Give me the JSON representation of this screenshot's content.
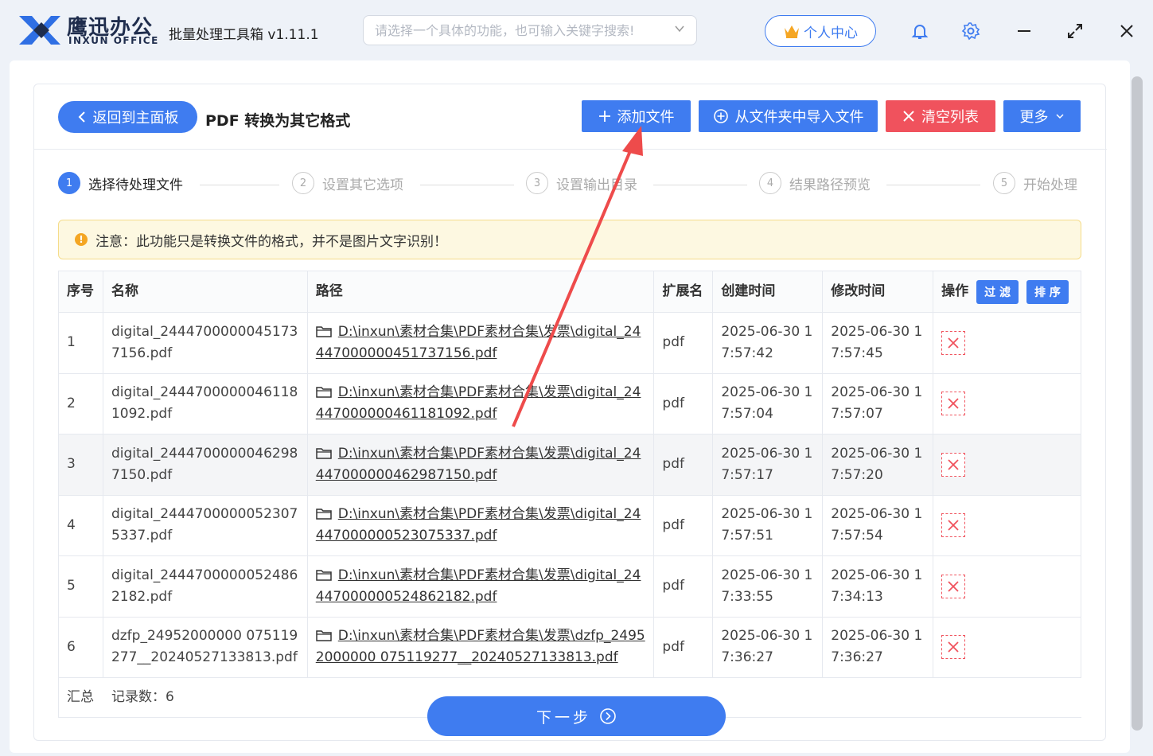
{
  "header": {
    "brand_cn": "鹰迅办公",
    "brand_en": "INXUN OFFICE",
    "app_title": "批量处理工具箱 v1.11.1",
    "search_placeholder": "请选择一个具体的功能，也可输入关键字搜索!",
    "user_center": "个人中心"
  },
  "toolbar": {
    "back_label": "返回到主面板",
    "page_title": "PDF 转换为其它格式",
    "add_file": "添加文件",
    "import_folder": "从文件夹中导入文件",
    "clear_list": "清空列表",
    "more": "更多"
  },
  "steps": [
    {
      "num": "1",
      "label": "选择待处理文件"
    },
    {
      "num": "2",
      "label": "设置其它选项"
    },
    {
      "num": "3",
      "label": "设置输出目录"
    },
    {
      "num": "4",
      "label": "结果路径预览"
    },
    {
      "num": "5",
      "label": "开始处理"
    }
  ],
  "notice": "注意：此功能只是转换文件的格式，并不是图片文字识别！",
  "table": {
    "headers": [
      "序号",
      "名称",
      "路径",
      "扩展名",
      "创建时间",
      "修改时间",
      "操作"
    ],
    "filter_label": "过 滤",
    "sort_label": "排 序",
    "rows": [
      {
        "idx": "1",
        "name": "digital_24447000000451737156.pdf",
        "path": "D:\\inxun\\素材合集\\PDF素材合集\\发票\\digital_24447000000451737156.pdf",
        "ext": "pdf",
        "created": "2025-06-30 17:57:42",
        "modified": "2025-06-30 17:57:45"
      },
      {
        "idx": "2",
        "name": "digital_24447000000461181092.pdf",
        "path": "D:\\inxun\\素材合集\\PDF素材合集\\发票\\digital_24447000000461181092.pdf",
        "ext": "pdf",
        "created": "2025-06-30 17:57:04",
        "modified": "2025-06-30 17:57:07"
      },
      {
        "idx": "3",
        "name": "digital_24447000000462987150.pdf",
        "path": "D:\\inxun\\素材合集\\PDF素材合集\\发票\\digital_24447000000462987150.pdf",
        "ext": "pdf",
        "created": "2025-06-30 17:57:17",
        "modified": "2025-06-30 17:57:20"
      },
      {
        "idx": "4",
        "name": "digital_24447000000523075337.pdf",
        "path": "D:\\inxun\\素材合集\\PDF素材合集\\发票\\digital_24447000000523075337.pdf",
        "ext": "pdf",
        "created": "2025-06-30 17:57:51",
        "modified": "2025-06-30 17:57:54"
      },
      {
        "idx": "5",
        "name": "digital_24447000000524862182.pdf",
        "path": "D:\\inxun\\素材合集\\PDF素材合集\\发票\\digital_24447000000524862182.pdf",
        "ext": "pdf",
        "created": "2025-06-30 17:33:55",
        "modified": "2025-06-30 17:34:13"
      },
      {
        "idx": "6",
        "name": "dzfp_24952000000 075119277__20240527133813.pdf",
        "path": "D:\\inxun\\素材合集\\PDF素材合集\\发票\\dzfp_24952000000 075119277__20240527133813.pdf",
        "ext": "pdf",
        "created": "2025-06-30 17:36:27",
        "modified": "2025-06-30 17:36:27"
      }
    ],
    "footer_label": "汇总",
    "footer_count": "记录数：6"
  },
  "next_button": "下一步",
  "colors": {
    "accent": "#3f7cf0",
    "danger": "#f0525d",
    "notice_bg": "#fdf8e1",
    "annotation_arrow": "#ee4b4b"
  }
}
